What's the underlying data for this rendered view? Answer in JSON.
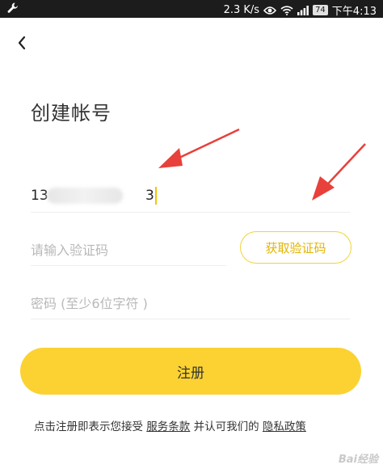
{
  "status_bar": {
    "network_speed": "2.3 K/s",
    "battery": "74",
    "time": "下午4:13",
    "icons": [
      "wrench-icon",
      "eye-icon",
      "wifi-icon",
      "signal-icon",
      "battery-icon"
    ]
  },
  "header": {
    "back_icon": "chevron-left-icon"
  },
  "title": "创建帐号",
  "phone": {
    "prefix": "13",
    "suffix": "3"
  },
  "code_field": {
    "placeholder": "请输入验证码"
  },
  "get_code_button": {
    "label": "获取验证码"
  },
  "password_field": {
    "placeholder": "密码 (至少6位字符 )"
  },
  "register_button": {
    "label": "注册"
  },
  "terms": {
    "prefix": "点击注册即表示您接受",
    "service_link": "服务条款",
    "middle": "并认可我们的",
    "privacy_link": "隐私政策"
  },
  "annotation": {
    "arrow_color": "#e8403a"
  },
  "colors": {
    "accent": "#fbd232",
    "accent_text": "#e3b400",
    "status_bar": "#1c1c1c"
  },
  "watermark": "Bai经验"
}
